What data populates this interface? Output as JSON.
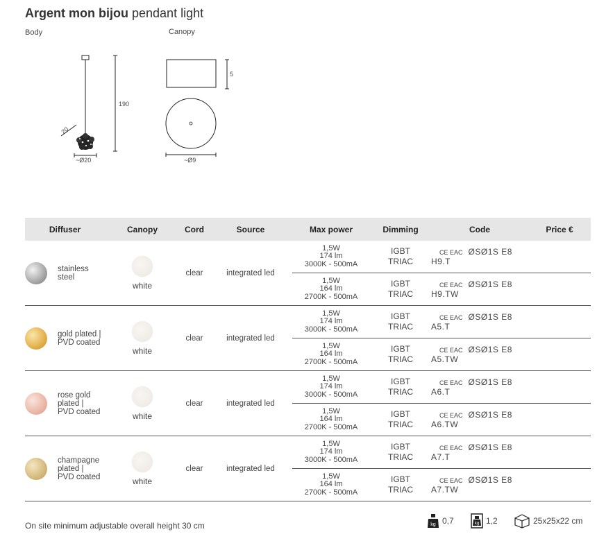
{
  "title": {
    "bold": "Argent mon bijou",
    "rest": "pendant light"
  },
  "drawing": {
    "body_label": "Body",
    "canopy_label": "Canopy",
    "dim_height": "190",
    "dim_side": "20",
    "dim_body_diam": "~Ø20",
    "dim_canopy_height": "5",
    "dim_canopy_diam": "~Ø9"
  },
  "table": {
    "headers": [
      "Diffuser",
      "Canopy",
      "Cord",
      "Source",
      "Max power",
      "Dimming",
      "Code",
      "Price €"
    ],
    "groups": [
      {
        "diffuser": [
          "stainless",
          "steel"
        ],
        "swatch_color": "#c9c9c9",
        "canopy": "white",
        "cord": "clear",
        "source": "integrated led",
        "rows": [
          {
            "power": [
              "1,5W",
              "174 lm",
              "3000K - 500mA"
            ],
            "dimming": [
              "IGBT",
              "TRIAC"
            ],
            "cert": "CE EAC",
            "code": "ØSØ1S E8 H9.T"
          },
          {
            "power": [
              "1,5W",
              "164 lm",
              "2700K - 500mA"
            ],
            "dimming": [
              "IGBT",
              "TRIAC"
            ],
            "cert": "CE EAC",
            "code": "ØSØ1S E8 H9.TW"
          }
        ]
      },
      {
        "diffuser": [
          "gold plated |",
          "PVD coated"
        ],
        "swatch_color": "#e4b85a",
        "canopy": "white",
        "cord": "clear",
        "source": "integrated led",
        "rows": [
          {
            "power": [
              "1,5W",
              "174 lm",
              "3000K - 500mA"
            ],
            "dimming": [
              "IGBT",
              "TRIAC"
            ],
            "cert": "CE EAC",
            "code": "ØSØ1S E8 A5.T"
          },
          {
            "power": [
              "1,5W",
              "164 lm",
              "2700K - 500mA"
            ],
            "dimming": [
              "IGBT",
              "TRIAC"
            ],
            "cert": "CE EAC",
            "code": "ØSØ1S E8 A5.TW"
          }
        ]
      },
      {
        "diffuser": [
          "rose gold",
          "plated |",
          "PVD coated"
        ],
        "swatch_color": "#ebbcae",
        "canopy": "white",
        "cord": "clear",
        "source": "integrated led",
        "rows": [
          {
            "power": [
              "1,5W",
              "174 lm",
              "3000K - 500mA"
            ],
            "dimming": [
              "IGBT",
              "TRIAC"
            ],
            "cert": "CE EAC",
            "code": "ØSØ1S E8 A6.T"
          },
          {
            "power": [
              "1,5W",
              "164 lm",
              "2700K - 500mA"
            ],
            "dimming": [
              "IGBT",
              "TRIAC"
            ],
            "cert": "CE EAC",
            "code": "ØSØ1S E8 A6.TW"
          }
        ]
      },
      {
        "diffuser": [
          "champagne",
          "plated |",
          "PVD coated"
        ],
        "swatch_color": "#d6bc80",
        "canopy": "white",
        "cord": "clear",
        "source": "integrated led",
        "rows": [
          {
            "power": [
              "1,5W",
              "174 lm",
              "3000K - 500mA"
            ],
            "dimming": [
              "IGBT",
              "TRIAC"
            ],
            "cert": "CE EAC",
            "code": "ØSØ1S E8 A7.T"
          },
          {
            "power": [
              "1,5W",
              "164 lm",
              "2700K - 500mA"
            ],
            "dimming": [
              "IGBT",
              "TRIAC"
            ],
            "cert": "CE EAC",
            "code": "ØSØ1S E8 A7.TW"
          }
        ]
      }
    ]
  },
  "footer": {
    "note": "On site minimum adjustable overall height 30 cm",
    "net_weight": "0,7",
    "gross_weight": "1,2",
    "package": "25x25x22 cm"
  }
}
